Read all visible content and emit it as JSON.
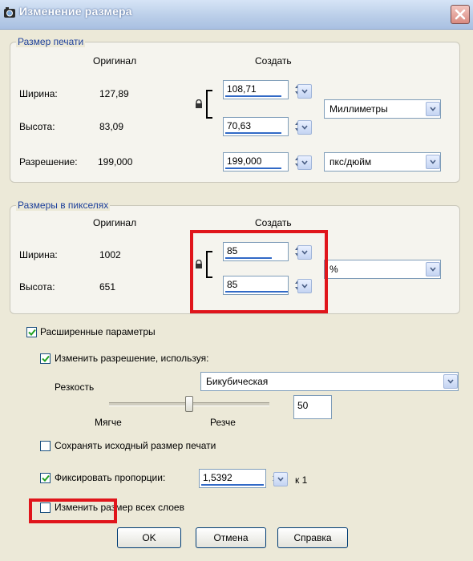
{
  "window": {
    "title": "Изменение размера"
  },
  "print_size": {
    "legend": "Размер печати",
    "col_original": "Оригинал",
    "col_create": "Создать",
    "width_label": "Ширина:",
    "width_original": "127,89",
    "width_value": "108,71",
    "height_label": "Высота:",
    "height_original": "83,09",
    "height_value": "70,63",
    "resolution_label": "Разрешение:",
    "resolution_original": "199,000",
    "resolution_value": "199,000",
    "units": "Миллиметры",
    "res_units": "пкс/дюйм"
  },
  "pixel_size": {
    "legend": "Размеры в пикселях",
    "col_original": "Оригинал",
    "col_create": "Создать",
    "width_label": "Ширина:",
    "width_original": "1002",
    "width_value": "85",
    "height_label": "Высота:",
    "height_original": "651",
    "height_value": "85",
    "units": "%"
  },
  "advanced": {
    "label": "Расширенные параметры",
    "checked": true,
    "resample_label": "Изменить разрешение, используя:",
    "resample_checked": true,
    "method": "Бикубическая",
    "sharpness_label": "Резкость",
    "softer_label": "Мягче",
    "sharper_label": "Резче",
    "sharpness_value": "50",
    "sharpness_level": 0.5,
    "keep_print_size_label": "Сохранять исходный размер печати",
    "keep_print_size_checked": false,
    "lock_ratio_label": "Фиксировать пропорции:",
    "lock_ratio_checked": true,
    "ratio_value": "1,5392",
    "ratio_suffix": "к 1",
    "all_layers_label": "Изменить размер всех слоев",
    "all_layers_checked": false
  },
  "buttons": {
    "ok": "OK",
    "cancel": "Отмена",
    "help": "Справка"
  },
  "colors": {
    "accent": "#3169c6",
    "highlight": "#e0151b",
    "legend": "#1c3f9a"
  },
  "icons": [
    "app-icon",
    "close-icon",
    "lock-icon",
    "spin-arrows-icon",
    "dropdown-arrow-icon",
    "checkmark-icon"
  ]
}
